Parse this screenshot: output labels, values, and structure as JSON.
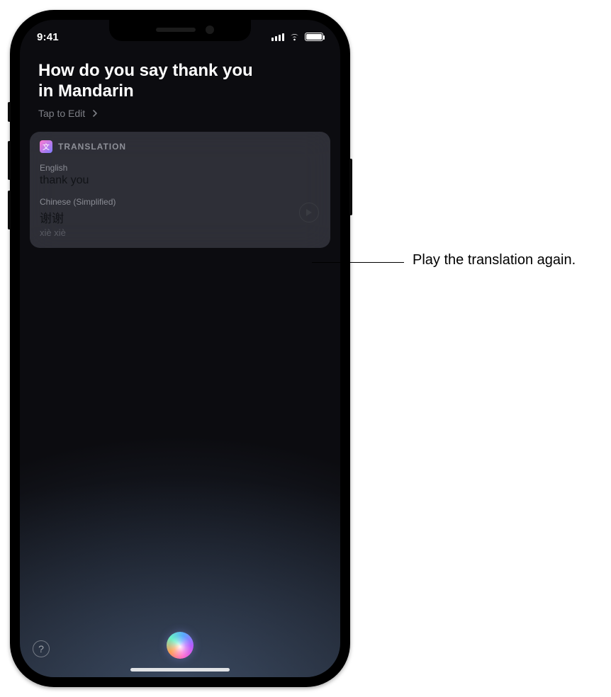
{
  "statusbar": {
    "time": "9:41"
  },
  "query": "How do you say thank you in Mandarin",
  "tap_edit": "Tap to Edit",
  "card": {
    "title": "TRANSLATION",
    "source_lang": "English",
    "source_text": "thank you",
    "target_lang": "Chinese (Simplified)",
    "target_text": "谢谢",
    "target_pinyin": "xiè xiè"
  },
  "callout": "Play the translation again."
}
